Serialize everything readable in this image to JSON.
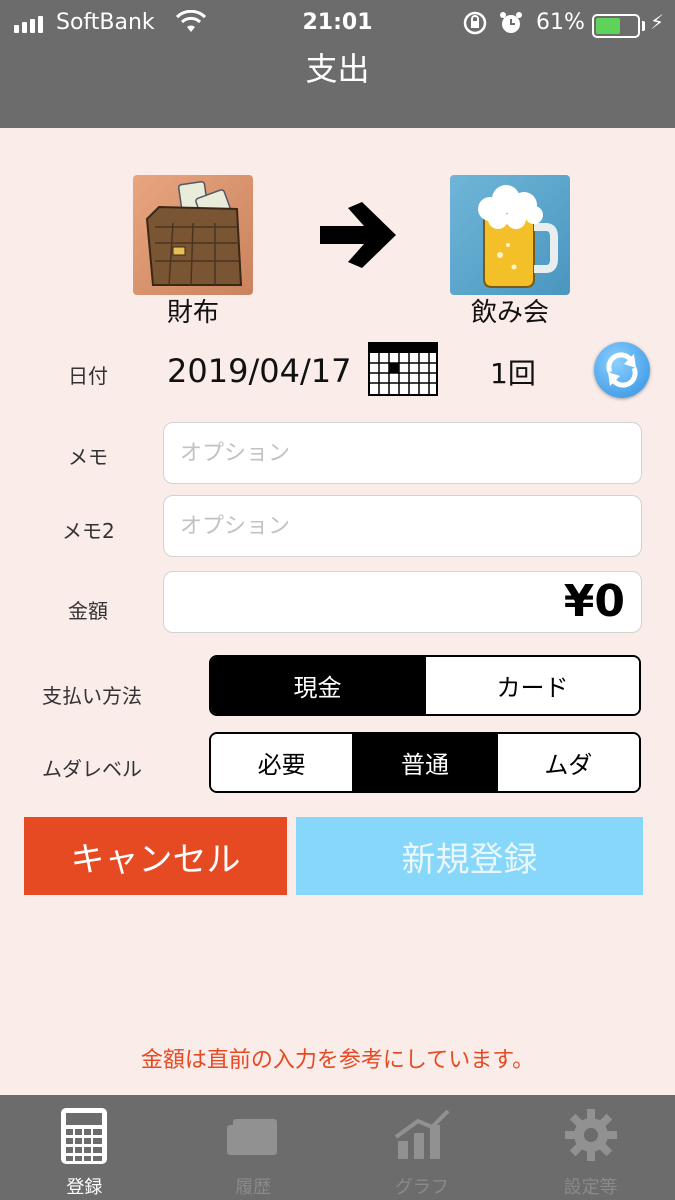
{
  "status_bar": {
    "carrier": "SoftBank",
    "time": "21:01",
    "battery_percent": "61%",
    "battery_level": 0.61,
    "icons": [
      "signal-icon",
      "wifi-icon",
      "rotation-lock-icon",
      "alarm-icon",
      "battery-icon",
      "charging-icon"
    ]
  },
  "nav": {
    "title": "支出"
  },
  "transfer": {
    "from_label": "財布",
    "to_label": "飲み会",
    "from_icon": "wallet-icon",
    "to_icon": "beer-icon",
    "arrow_icon": "arrow-right-icon"
  },
  "date_row": {
    "label": "日付",
    "value": "2019/04/17",
    "count": "1回",
    "calendar_icon": "calendar-icon",
    "refresh_icon": "refresh-icon"
  },
  "memo": {
    "label": "メモ",
    "placeholder": "オプション",
    "value": ""
  },
  "memo2": {
    "label": "メモ2",
    "placeholder": "オプション",
    "value": ""
  },
  "amount": {
    "label": "金額",
    "value": "¥0"
  },
  "payment_method": {
    "label": "支払い方法",
    "options": [
      "現金",
      "カード"
    ],
    "selected": "現金"
  },
  "waste_level": {
    "label": "ムダレベル",
    "options": [
      "必要",
      "普通",
      "ムダ"
    ],
    "selected": "普通"
  },
  "buttons": {
    "cancel": "キャンセル",
    "register": "新規登録"
  },
  "notice": "金額は直前の入力を参考にしています。",
  "colors": {
    "background": "#f9ece9",
    "bar": "#6c6c6c",
    "cancel": "#e64a23",
    "register": "#86d7f9",
    "notice": "#e64a23"
  },
  "tabbar": {
    "tabs": [
      {
        "label": "登録",
        "icon": "calculator-icon",
        "active": true
      },
      {
        "label": "履歴",
        "icon": "history-icon",
        "active": false
      },
      {
        "label": "グラフ",
        "icon": "graph-icon",
        "active": false
      },
      {
        "label": "設定等",
        "icon": "gear-icon",
        "active": false
      }
    ]
  }
}
